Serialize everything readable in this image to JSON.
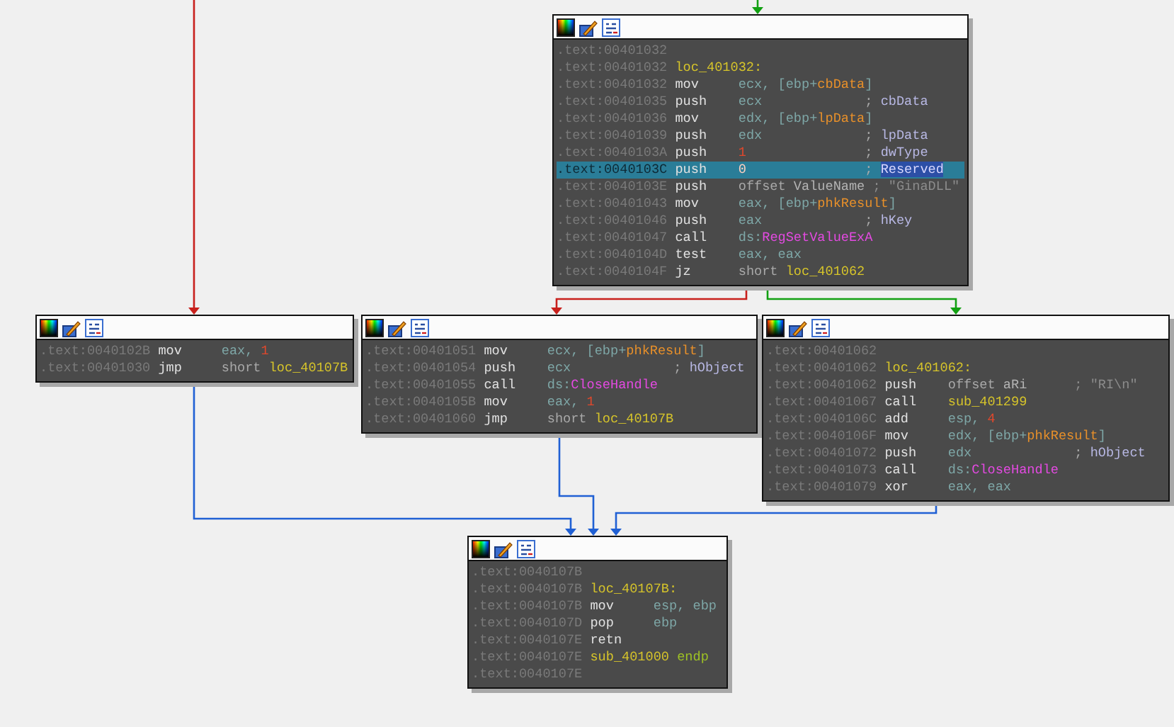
{
  "nodes": [
    {
      "lines": [
        {
          "address": ".text:00401032",
          "selected": false
        },
        {
          "address": ".text:00401032",
          "selected": false,
          "operands": [
            {
              "text": "loc_401032:",
              "kind": "name"
            }
          ]
        },
        {
          "address": ".text:00401032",
          "selected": false,
          "mnemonic": "mov",
          "operands": [
            {
              "text": "ecx, [ebp+",
              "kind": "reg"
            },
            {
              "text": "cbData",
              "kind": "var"
            },
            {
              "text": "]",
              "kind": "reg"
            }
          ]
        },
        {
          "address": ".text:00401035",
          "selected": false,
          "mnemonic": "push",
          "operands": [
            {
              "text": "ecx",
              "kind": "reg"
            }
          ],
          "comment": [
            {
              "text": "; ",
              "kind": "plain"
            },
            {
              "text": "cbData",
              "kind": "arg"
            }
          ]
        },
        {
          "address": ".text:00401036",
          "selected": false,
          "mnemonic": "mov",
          "operands": [
            {
              "text": "edx, [ebp+",
              "kind": "reg"
            },
            {
              "text": "lpData",
              "kind": "var"
            },
            {
              "text": "]",
              "kind": "reg"
            }
          ]
        },
        {
          "address": ".text:00401039",
          "selected": false,
          "mnemonic": "push",
          "operands": [
            {
              "text": "edx",
              "kind": "reg"
            }
          ],
          "comment": [
            {
              "text": "; ",
              "kind": "plain"
            },
            {
              "text": "lpData",
              "kind": "arg"
            }
          ]
        },
        {
          "address": ".text:0040103A",
          "selected": false,
          "mnemonic": "push",
          "operands": [
            {
              "text": "1",
              "kind": "num"
            }
          ],
          "comment": [
            {
              "text": "; ",
              "kind": "plain"
            },
            {
              "text": "dwType",
              "kind": "arg"
            }
          ]
        },
        {
          "address": ".text:0040103C",
          "selected": true,
          "mnemonic": "push",
          "operands": [
            {
              "text": "0",
              "kind": "num"
            }
          ],
          "comment": [
            {
              "text": "; ",
              "kind": "plain"
            },
            {
              "text": "Reserved",
              "kind": "highlight"
            }
          ]
        },
        {
          "address": ".text:0040103E",
          "selected": false,
          "mnemonic": "push",
          "operands": [
            {
              "text": "offset ",
              "kind": "plain"
            },
            {
              "text": "ValueName",
              "kind": "data"
            }
          ],
          "comment": [
            {
              "text": "; \"GinaDLL\"",
              "kind": "string"
            }
          ]
        },
        {
          "address": ".text:00401043",
          "selected": false,
          "mnemonic": "mov",
          "operands": [
            {
              "text": "eax, [ebp+",
              "kind": "reg"
            },
            {
              "text": "phkResult",
              "kind": "var"
            },
            {
              "text": "]",
              "kind": "reg"
            }
          ]
        },
        {
          "address": ".text:00401046",
          "selected": false,
          "mnemonic": "push",
          "operands": [
            {
              "text": "eax",
              "kind": "reg"
            }
          ],
          "comment": [
            {
              "text": "; ",
              "kind": "plain"
            },
            {
              "text": "hKey",
              "kind": "arg"
            }
          ]
        },
        {
          "address": ".text:00401047",
          "selected": false,
          "mnemonic": "call",
          "operands": [
            {
              "text": "ds:",
              "kind": "reg"
            },
            {
              "text": "RegSetValueExA",
              "kind": "import"
            }
          ]
        },
        {
          "address": ".text:0040104D",
          "selected": false,
          "mnemonic": "test",
          "operands": [
            {
              "text": "eax, eax",
              "kind": "reg"
            }
          ]
        },
        {
          "address": ".text:0040104F",
          "selected": false,
          "mnemonic": "jz",
          "operands": [
            {
              "text": "short ",
              "kind": "plain"
            },
            {
              "text": "loc_401062",
              "kind": "name"
            }
          ]
        }
      ]
    },
    {
      "lines": [
        {
          "address": ".text:0040102B",
          "selected": false,
          "mnemonic": "mov",
          "operands": [
            {
              "text": "eax, ",
              "kind": "reg"
            },
            {
              "text": "1",
              "kind": "num"
            }
          ]
        },
        {
          "address": ".text:00401030",
          "selected": false,
          "mnemonic": "jmp",
          "operands": [
            {
              "text": "short ",
              "kind": "plain"
            },
            {
              "text": "loc_40107B",
              "kind": "name"
            }
          ]
        }
      ]
    },
    {
      "lines": [
        {
          "address": ".text:00401051",
          "selected": false,
          "mnemonic": "mov",
          "operands": [
            {
              "text": "ecx, [ebp+",
              "kind": "reg"
            },
            {
              "text": "phkResult",
              "kind": "var"
            },
            {
              "text": "]",
              "kind": "reg"
            }
          ]
        },
        {
          "address": ".text:00401054",
          "selected": false,
          "mnemonic": "push",
          "operands": [
            {
              "text": "ecx",
              "kind": "reg"
            }
          ],
          "comment": [
            {
              "text": "; ",
              "kind": "plain"
            },
            {
              "text": "hObject",
              "kind": "arg"
            }
          ]
        },
        {
          "address": ".text:00401055",
          "selected": false,
          "mnemonic": "call",
          "operands": [
            {
              "text": "ds:",
              "kind": "reg"
            },
            {
              "text": "CloseHandle",
              "kind": "import"
            }
          ]
        },
        {
          "address": ".text:0040105B",
          "selected": false,
          "mnemonic": "mov",
          "operands": [
            {
              "text": "eax, ",
              "kind": "reg"
            },
            {
              "text": "1",
              "kind": "num"
            }
          ]
        },
        {
          "address": ".text:00401060",
          "selected": false,
          "mnemonic": "jmp",
          "operands": [
            {
              "text": "short ",
              "kind": "plain"
            },
            {
              "text": "loc_40107B",
              "kind": "name"
            }
          ]
        }
      ]
    },
    {
      "lines": [
        {
          "address": ".text:00401062",
          "selected": false
        },
        {
          "address": ".text:00401062",
          "selected": false,
          "operands": [
            {
              "text": "loc_401062:",
              "kind": "name"
            }
          ]
        },
        {
          "address": ".text:00401062",
          "selected": false,
          "mnemonic": "push",
          "operands": [
            {
              "text": "offset ",
              "kind": "plain"
            },
            {
              "text": "aRi",
              "kind": "data"
            }
          ],
          "comment": [
            {
              "text": "; \"RI\\n\"",
              "kind": "string"
            }
          ]
        },
        {
          "address": ".text:00401067",
          "selected": false,
          "mnemonic": "call",
          "operands": [
            {
              "text": "sub_401299",
              "kind": "name"
            }
          ]
        },
        {
          "address": ".text:0040106C",
          "selected": false,
          "mnemonic": "add",
          "operands": [
            {
              "text": "esp, ",
              "kind": "reg"
            },
            {
              "text": "4",
              "kind": "num"
            }
          ]
        },
        {
          "address": ".text:0040106F",
          "selected": false,
          "mnemonic": "mov",
          "operands": [
            {
              "text": "edx, [ebp+",
              "kind": "reg"
            },
            {
              "text": "phkResult",
              "kind": "var"
            },
            {
              "text": "]",
              "kind": "reg"
            }
          ]
        },
        {
          "address": ".text:00401072",
          "selected": false,
          "mnemonic": "push",
          "operands": [
            {
              "text": "edx",
              "kind": "reg"
            }
          ],
          "comment": [
            {
              "text": "; ",
              "kind": "plain"
            },
            {
              "text": "hObject",
              "kind": "arg"
            }
          ]
        },
        {
          "address": ".text:00401073",
          "selected": false,
          "mnemonic": "call",
          "operands": [
            {
              "text": "ds:",
              "kind": "reg"
            },
            {
              "text": "CloseHandle",
              "kind": "import"
            }
          ]
        },
        {
          "address": ".text:00401079",
          "selected": false,
          "mnemonic": "xor",
          "operands": [
            {
              "text": "eax, eax",
              "kind": "reg"
            }
          ]
        }
      ]
    },
    {
      "lines": [
        {
          "address": ".text:0040107B",
          "selected": false
        },
        {
          "address": ".text:0040107B",
          "selected": false,
          "operands": [
            {
              "text": "loc_40107B:",
              "kind": "name"
            }
          ]
        },
        {
          "address": ".text:0040107B",
          "selected": false,
          "mnemonic": "mov",
          "operands": [
            {
              "text": "esp, ebp",
              "kind": "reg"
            }
          ]
        },
        {
          "address": ".text:0040107D",
          "selected": false,
          "mnemonic": "pop",
          "operands": [
            {
              "text": "ebp",
              "kind": "reg"
            }
          ]
        },
        {
          "address": ".text:0040107E",
          "selected": false,
          "mnemonic": "retn"
        },
        {
          "address": ".text:0040107E",
          "selected": false,
          "operands": [
            {
              "text": "sub_401000 ",
              "kind": "name"
            },
            {
              "text": "endp",
              "kind": "endp"
            }
          ]
        },
        {
          "address": ".text:0040107E",
          "selected": false
        }
      ]
    }
  ],
  "edges": [
    {
      "color": "#c8201c"
    },
    {
      "color": "#12a012"
    },
    {
      "color": "#c8201c"
    },
    {
      "color": "#12a012"
    },
    {
      "color": "#2060d4"
    },
    {
      "color": "#2060d4"
    },
    {
      "color": "#2060d4"
    }
  ]
}
